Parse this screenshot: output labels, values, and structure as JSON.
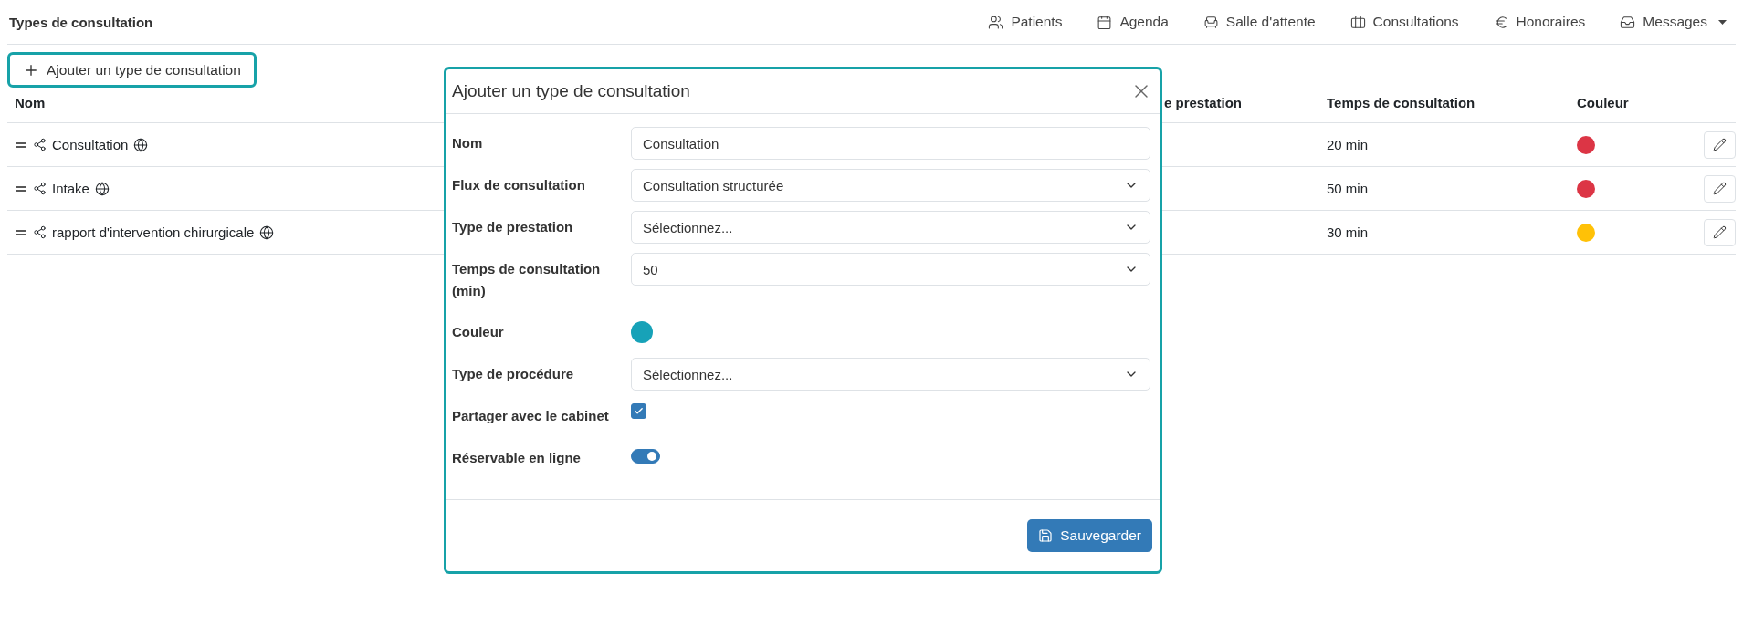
{
  "page_title": "Types de consultation",
  "nav": [
    {
      "label": "Patients",
      "kind": "patients"
    },
    {
      "label": "Agenda",
      "kind": "agenda"
    },
    {
      "label": "Salle d'attente",
      "kind": "waiting"
    },
    {
      "label": "Consultations",
      "kind": "consultations"
    },
    {
      "label": "Honoraires",
      "kind": "fees"
    },
    {
      "label": "Messages",
      "kind": "messages",
      "dropdown": true
    }
  ],
  "add_button": {
    "label": "Ajouter un type de consultation"
  },
  "table": {
    "columns": [
      "Nom",
      "e prestation",
      "Temps de consultation",
      "Couleur"
    ],
    "rows": [
      {
        "name": "Consultation",
        "duration": "20 min",
        "color": "#dc3545"
      },
      {
        "name": "Intake",
        "duration": "50 min",
        "color": "#dc3545"
      },
      {
        "name": "rapport d'intervention chirurgicale",
        "duration": "30 min",
        "color": "#ffc107"
      }
    ]
  },
  "modal": {
    "title": "Ajouter un type de consultation",
    "fields": [
      {
        "label": "Nom",
        "kind": "text",
        "value": "Consultation"
      },
      {
        "label": "Flux de consultation",
        "kind": "select",
        "value": "Consultation structurée"
      },
      {
        "label": "Type de prestation",
        "kind": "select",
        "value": "Sélectionnez..."
      },
      {
        "label": "Temps de consultation (min)",
        "kind": "select",
        "value": "50"
      },
      {
        "label": "Couleur",
        "kind": "color",
        "color": "#17a2b8"
      },
      {
        "label": "Type de procédure",
        "kind": "select",
        "value": "Sélectionnez..."
      },
      {
        "label": "Partager avec le cabinet",
        "kind": "checkbox",
        "checked": true
      },
      {
        "label": "Réservable en ligne",
        "kind": "switch",
        "on": true
      }
    ],
    "save_button": {
      "label": "Sauvegarder"
    }
  }
}
